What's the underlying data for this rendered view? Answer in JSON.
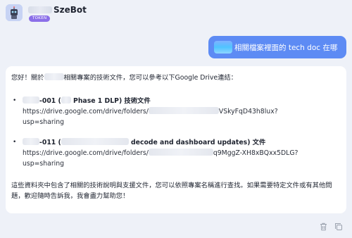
{
  "header": {
    "bot_name": "SzeBot",
    "badge": "TOKEN"
  },
  "user_message": {
    "text": "相關檔案裡面的 tech doc 在哪"
  },
  "reply": {
    "intro_prefix": "您好！關於",
    "intro_suffix": "相關專案的技術文件，您可以參考以下Google Drive連結：",
    "items": [
      {
        "title_a": "-001 (",
        "title_b": " Phase 1 DLP) 技術文件",
        "url_prefix": "https://drive.google.com/drive/folders/",
        "url_suffix": "VSkyFqD43h8lux?",
        "url_tail": "usp=sharing"
      },
      {
        "title_a": "-011 (",
        "title_b": " decode and dashboard updates) 文件",
        "url_prefix": "https://drive.google.com/drive/folders/",
        "url_suffix": "q9MggZ-XH8xBQxx5DLG?",
        "url_tail": "usp=sharing"
      }
    ],
    "closing": "這些資料夾中包含了相關的技術說明與支援文件，您可以依照專案名稱進行查找。如果需要特定文件或有其他問題，歡迎隨時告訴我，我會盡力幫助您！"
  },
  "actions": {
    "delete_icon": "trash-icon",
    "copy_icon": "copy-icon"
  },
  "colors": {
    "page_bg": "#eef1f8",
    "user_bubble": "#5d8bf4",
    "badge": "#8b6fe8"
  }
}
